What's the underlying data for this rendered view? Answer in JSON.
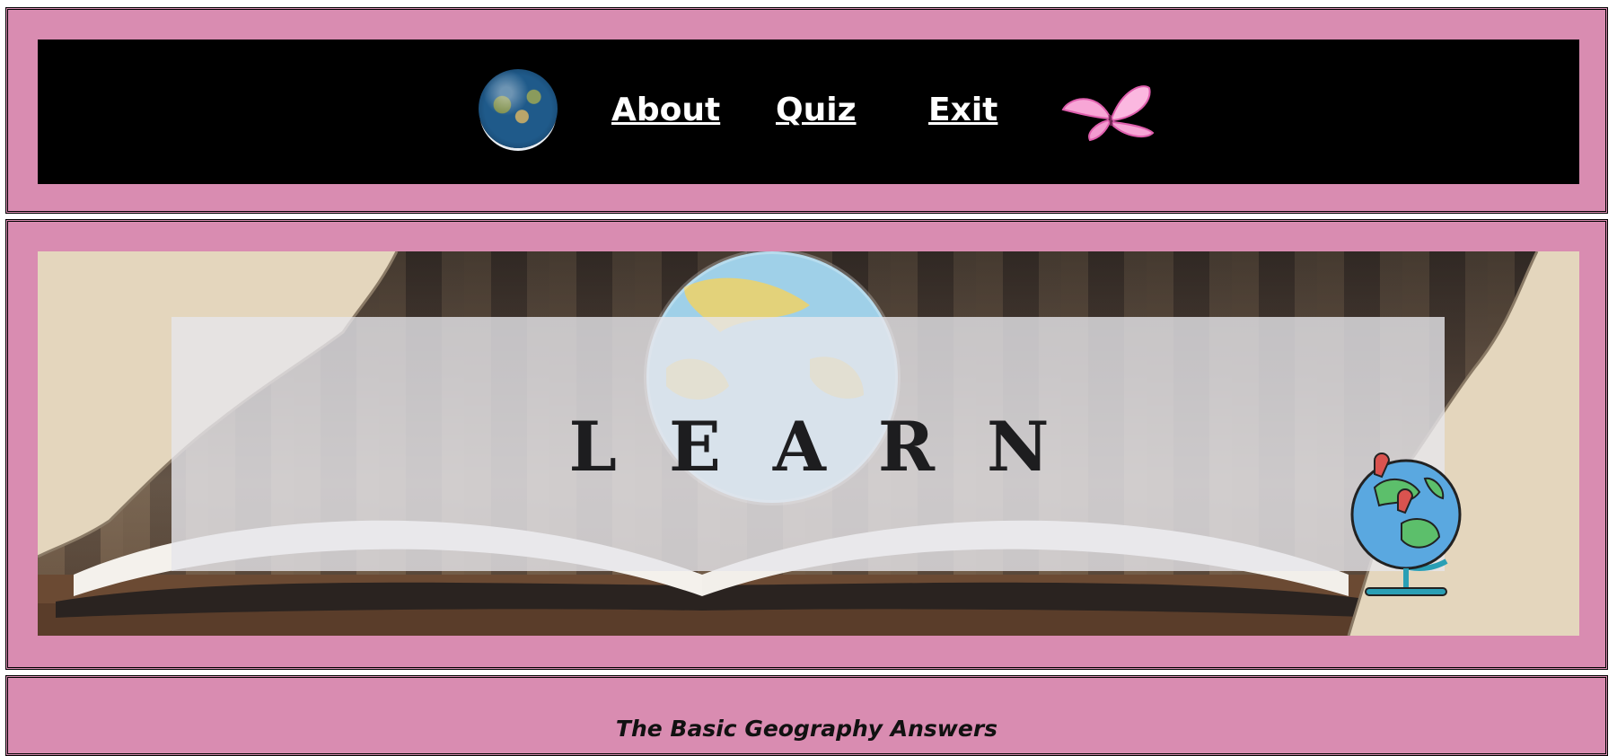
{
  "nav": {
    "items": [
      {
        "label": "About"
      },
      {
        "label": "Quiz"
      },
      {
        "label": "Exit"
      }
    ]
  },
  "hero": {
    "title": "LEARN"
  },
  "footer": {
    "text": "The Basic Geography Answers"
  },
  "colors": {
    "panel": "#d98cb1",
    "nav_bg": "#000000",
    "link": "#ffffff"
  },
  "icons": [
    "earth-globe-icon",
    "butterfly-icon",
    "desk-globe-icon"
  ]
}
